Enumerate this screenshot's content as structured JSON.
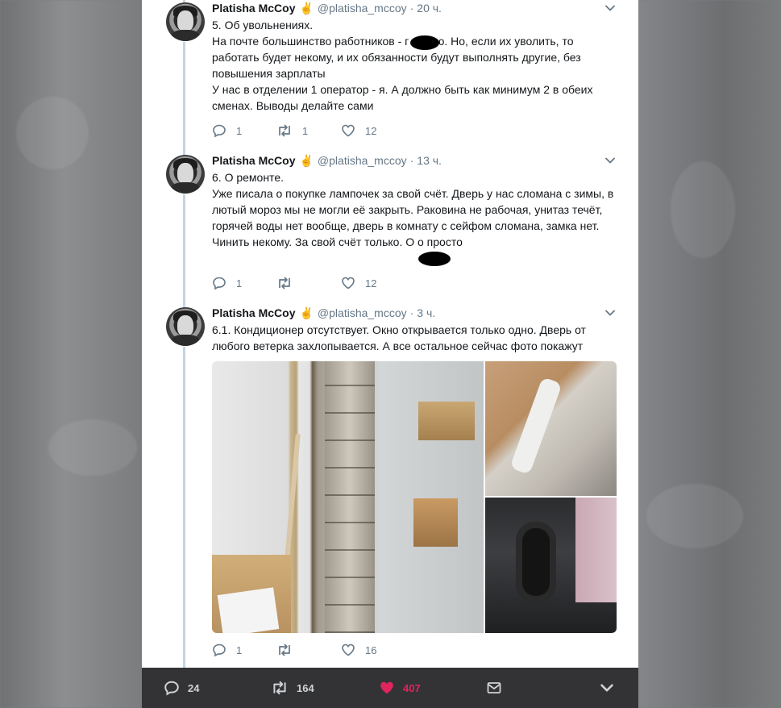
{
  "colors": {
    "accent_like": "#e0245e",
    "muted": "#657786",
    "thread_line": "#c4d4e4",
    "bottom_bar": "#333335"
  },
  "tweets": [
    {
      "name": "Platisha McCoy",
      "badge_icon": "victory-hand-emoji",
      "handle": "@platisha_mccoy",
      "time": "20 ч.",
      "text": "5. Об увольнениях.\nНа почте большинство работников - г      , знаю. Но, если их уволить, то работать будет некому, и их обязанности будут выполнять другие, без повышения зарплаты\nУ нас в отделении 1 оператор - я. А должно быть как минимум 2 в обеих сменах. Выводы делайте сами",
      "replies": "1",
      "retweets": "1",
      "likes": "12"
    },
    {
      "name": "Platisha McCoy",
      "badge_icon": "victory-hand-emoji",
      "handle": "@platisha_mccoy",
      "time": "13 ч.",
      "text": "6. О ремонте.\nУже писала о покупке лампочек за свой счёт. Дверь у нас сломана с зимы, в лютый мороз мы не могли её закрыть. Раковина не рабочая, унитаз течёт, горячей воды нет вообще, дверь в комнату с сейфом сломана, замка нет.\nЧинить некому. За свой счёт только. О        о просто",
      "replies": "1",
      "retweets": "",
      "likes": "12"
    },
    {
      "name": "Platisha McCoy",
      "badge_icon": "victory-hand-emoji",
      "handle": "@platisha_mccoy",
      "time": "3 ч.",
      "text": "6.1. Кондиционер отсутствует. Окно открывается только одно. Дверь от любого ветерка захлопывается. А все остальное сейчас фото покажут",
      "replies": "1",
      "retweets": "",
      "likes": "16"
    }
  ],
  "bottom_bar": {
    "replies": "24",
    "retweets": "164",
    "likes": "407"
  }
}
